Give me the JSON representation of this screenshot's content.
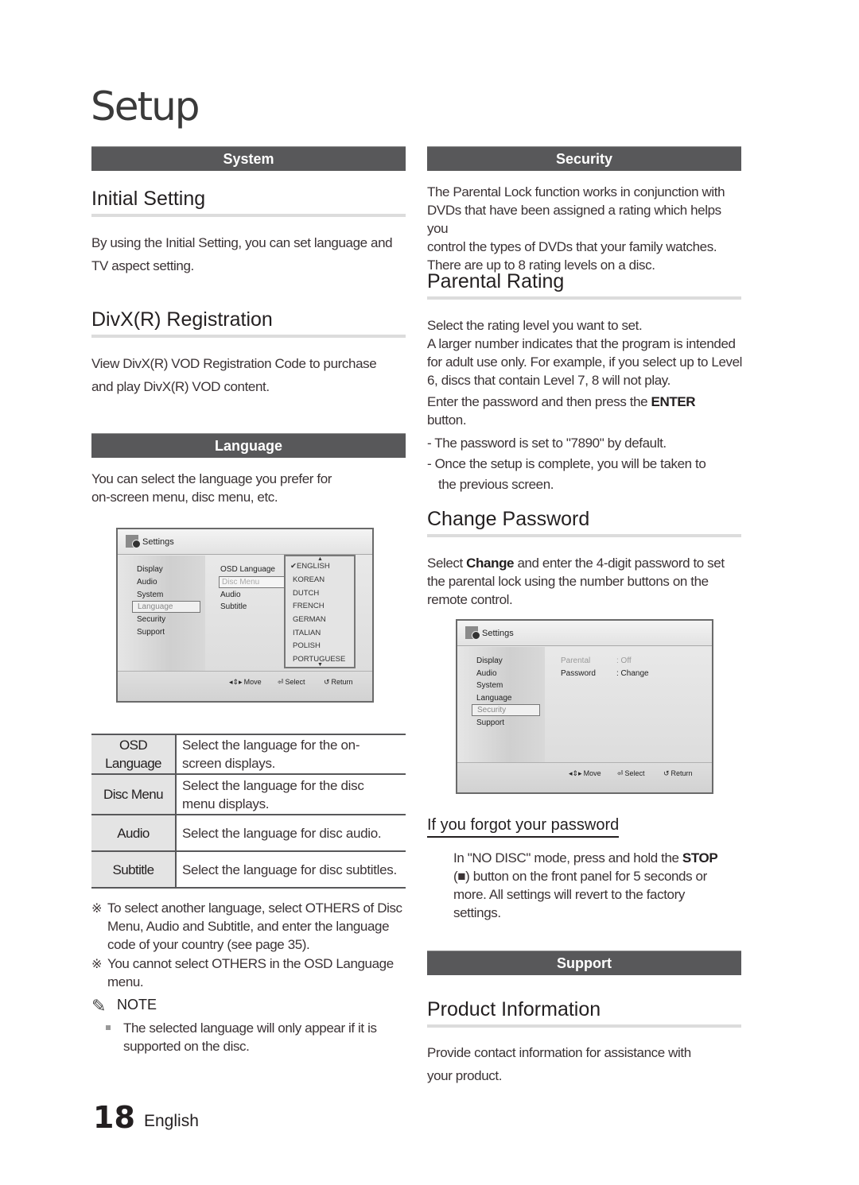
{
  "page": {
    "title": "Setup",
    "number": "18",
    "language": "English"
  },
  "left": {
    "system_bar": "System",
    "initial_setting": {
      "heading": "Initial Setting",
      "text_lines": [
        "By using the Initial Setting, you can set language and",
        "TV aspect setting."
      ]
    },
    "divx": {
      "heading": "DivX(R) Registration",
      "text_lines": [
        "View DivX(R) VOD Registration Code to purchase",
        "and play DivX(R) VOD content."
      ]
    },
    "language_bar": "Language",
    "language_intro_lines": [
      "You can select the language you prefer for",
      "on-screen menu, disc menu, etc."
    ],
    "screen": {
      "title": "Settings",
      "menu": [
        "Display",
        "Audio",
        "System",
        "Language",
        "Security",
        "Support"
      ],
      "selected_menu": "Language",
      "submenu": [
        "OSD Language",
        "Disc Menu",
        "Audio",
        "Subtitle"
      ],
      "selected_submenu": "Disc Menu",
      "options": [
        "ENGLISH",
        "KOREAN",
        "DUTCH",
        "FRENCH",
        "GERMAN",
        "ITALIAN",
        "POLISH",
        "PORTUGUESE"
      ],
      "checked_option": "ENGLISH",
      "footer": {
        "move": "Move",
        "select": "Select",
        "return": "Return"
      }
    },
    "table": [
      {
        "key_lines": [
          "OSD",
          "Language"
        ],
        "value_lines": [
          "Select the language for the on-",
          "screen displays."
        ]
      },
      {
        "key_lines": [
          "Disc Menu"
        ],
        "value_lines": [
          "Select the language for the disc",
          "menu displays."
        ]
      },
      {
        "key_lines": [
          "Audio"
        ],
        "value_lines": [
          "Select the language for disc audio."
        ]
      },
      {
        "key_lines": [
          "Subtitle"
        ],
        "value_lines": [
          "Select the language for disc subtitles."
        ]
      }
    ],
    "notes": [
      {
        "mark": "※",
        "lines": [
          "To select another language, select OTHERS of Disc",
          "Menu, Audio and Subtitle, and enter the language",
          "code of your country (see page 35)."
        ]
      },
      {
        "mark": "※",
        "lines": [
          "You cannot select OTHERS in the OSD Language",
          "menu."
        ]
      }
    ],
    "note_title": "NOTE",
    "note_bullet_lines": [
      "The selected language will only appear if it is",
      "supported on the disc."
    ]
  },
  "right": {
    "security_bar": "Security",
    "security_intro_lines": [
      "The Parental Lock function works in conjunction with",
      "DVDs that have been assigned a rating which helps you",
      "control the types of DVDs that your family watches.",
      "There are up to 8 rating levels on a disc."
    ],
    "parental_rating": {
      "heading": "Parental Rating",
      "para1_lines": [
        "Select the rating level you want to set.",
        "A larger number indicates that the program is intended",
        "for adult use only. For example, if you select up to Level",
        "6, discs that contain Level 7, 8 will not play."
      ],
      "para2_prefix": "Enter the password and then press the ",
      "para2_bold": "ENTER",
      "para2_line2": "button.",
      "dash1": "- The password is set to \"7890\" by default.",
      "dash2_line1": "- Once the setup is complete, you will be taken to",
      "dash2_line2": "the previous screen."
    },
    "change_password": {
      "heading": "Change Password",
      "line1_prefix": "Select ",
      "line1_bold": "Change",
      "line1_suffix": " and enter the 4-digit password to set",
      "line2": "the parental lock using the number buttons on the",
      "line3": "remote control."
    },
    "screen": {
      "title": "Settings",
      "menu": [
        "Display",
        "Audio",
        "System",
        "Language",
        "Security",
        "Support"
      ],
      "selected_menu": "Security",
      "rows": [
        {
          "label": "Parental",
          "value": ": Off",
          "dimmed": true
        },
        {
          "label": "Password",
          "value": ": Change",
          "dimmed": false
        }
      ],
      "footer": {
        "move": "Move",
        "select": "Select",
        "return": "Return"
      }
    },
    "forgot": {
      "heading": "If you forgot your password",
      "line1_prefix": "In \"NO DISC\" mode, press and hold the ",
      "line1_bold": "STOP",
      "line2": "(■) button on the front panel for 5 seconds or",
      "line3": "more. All settings will revert to the factory",
      "line4": "settings."
    },
    "support_bar": "Support",
    "product_info": {
      "heading": "Product Information",
      "text_lines": [
        "Provide contact information for assistance with",
        "your product."
      ]
    }
  }
}
